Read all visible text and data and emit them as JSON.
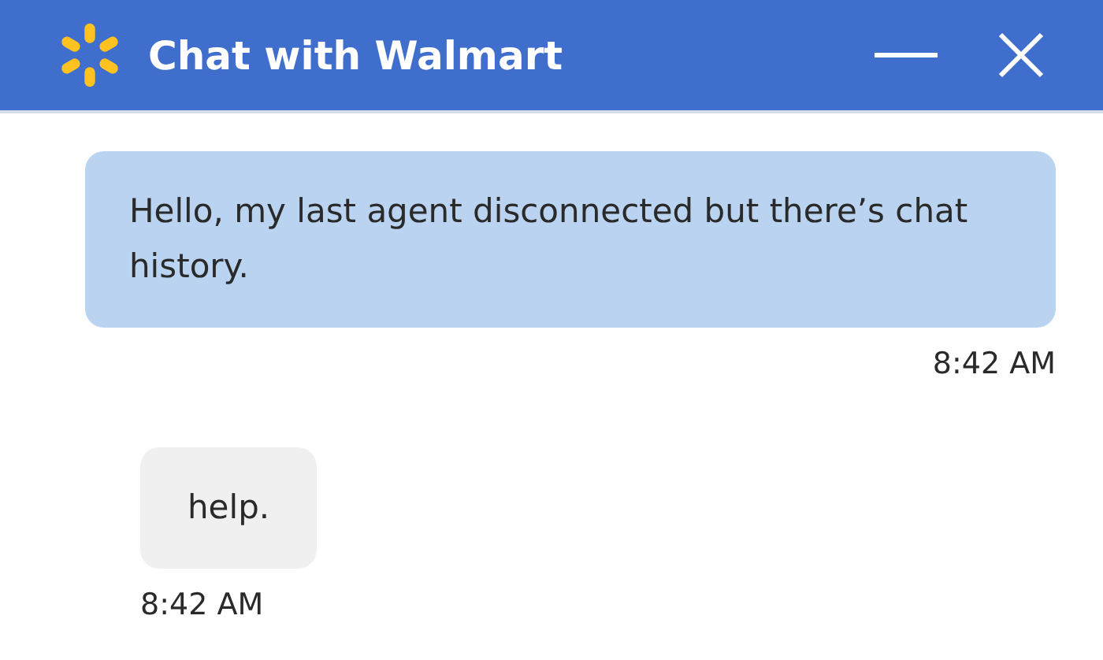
{
  "window": {
    "title": "Chat with Walmart"
  },
  "messages": [
    {
      "kind": "user",
      "text": "Hello, my last agent disconnected but there’s chat history.",
      "time": "8:42 AM"
    },
    {
      "kind": "agent",
      "text": "help.",
      "time": "8:42 AM"
    }
  ]
}
